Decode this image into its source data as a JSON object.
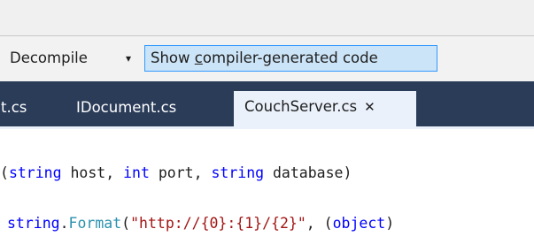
{
  "toolbar": {
    "decompile_label": "Decompile",
    "dropdown_glyph": "▾",
    "show_generated_prefix": "Show ",
    "show_generated_mnemonic": "c",
    "show_generated_rest": "ompiler-generated code"
  },
  "tabs": [
    {
      "label": "t.cs"
    },
    {
      "label": "IDocument.cs"
    },
    {
      "label": "CouchServer.cs",
      "active": true,
      "close": "✕"
    }
  ],
  "code": {
    "line1": [
      {
        "t": "(",
        "c": "plain"
      },
      {
        "t": "string",
        "c": "kw"
      },
      {
        "t": " host, ",
        "c": "plain"
      },
      {
        "t": "int",
        "c": "kw"
      },
      {
        "t": " port, ",
        "c": "plain"
      },
      {
        "t": "string",
        "c": "kw"
      },
      {
        "t": " database)",
        "c": "plain"
      }
    ],
    "line2": [
      {
        "t": "string",
        "c": "kw"
      },
      {
        "t": ".",
        "c": "plain"
      },
      {
        "t": "Format",
        "c": "ty"
      },
      {
        "t": "(",
        "c": "plain"
      },
      {
        "t": "\"http://{0}:{1}/{2}\"",
        "c": "str"
      },
      {
        "t": ", (",
        "c": "plain"
      },
      {
        "t": "object",
        "c": "kw"
      },
      {
        "t": ")",
        "c": "plain"
      }
    ]
  },
  "colors": {
    "tab_strip": "#2b3c59",
    "active_tab": "#eaf1fb",
    "keyword": "#0000ff",
    "type": "#2b91af",
    "string": "#a31515",
    "toggle_highlight": "#cce4f7",
    "toggle_border": "#3399ff"
  }
}
